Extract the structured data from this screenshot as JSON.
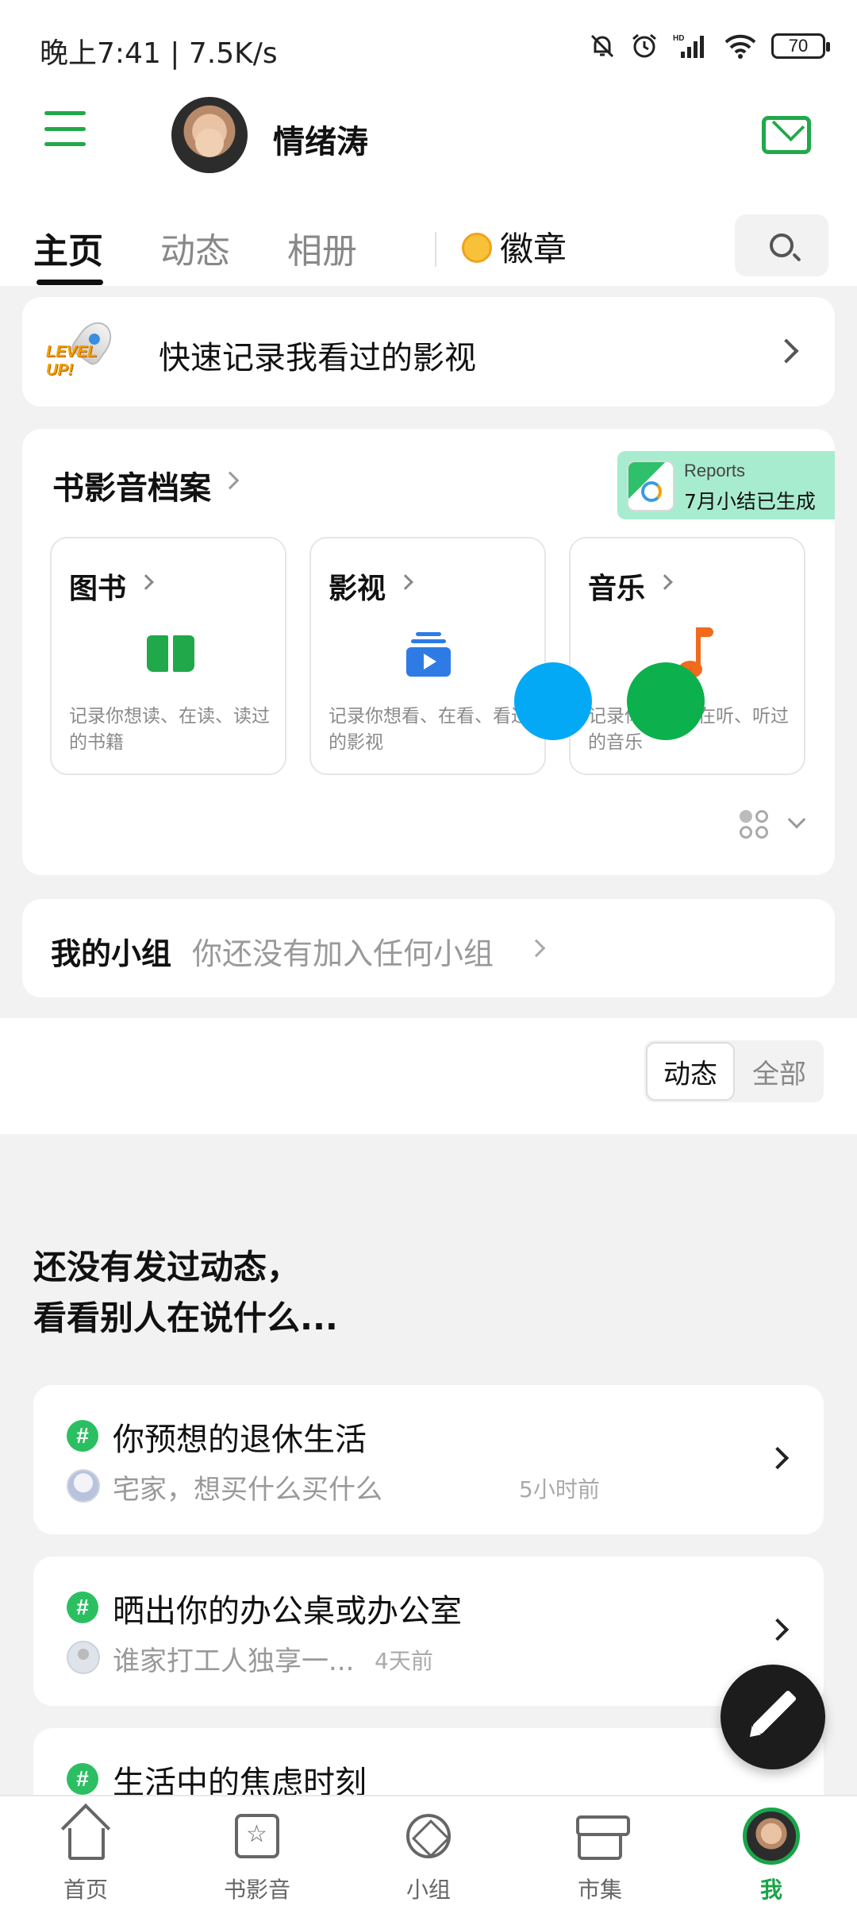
{
  "status_bar": {
    "time": "晚上7:41 | 7.5K/s",
    "battery": "70"
  },
  "header": {
    "username": "情绪涛"
  },
  "tabs": [
    {
      "label": "主页"
    },
    {
      "label": "动态"
    },
    {
      "label": "相册"
    }
  ],
  "badge_tab": {
    "label": "徽章"
  },
  "quick_record": {
    "badge_text": "LEVEL UP!",
    "text": "快速记录我看过的影视"
  },
  "archive": {
    "title": "书影音档案",
    "reports": {
      "label": "Reports",
      "message": "7月小结已生成"
    },
    "items": [
      {
        "title": "图书",
        "desc": "记录你想读、在读、读过的书籍"
      },
      {
        "title": "影视",
        "desc": "记录你想看、在看、看过的影视"
      },
      {
        "title": "音乐",
        "desc": "记录你想听、在听、听过的音乐"
      }
    ]
  },
  "group": {
    "title": "我的小组",
    "subtitle": "你还没有加入任何小组"
  },
  "filter": {
    "active": "动态",
    "inactive": "全部"
  },
  "empty_state": {
    "line1": "还没有发过动态，",
    "line2": "看看别人在说什么..."
  },
  "topics": [
    {
      "title": "你预想的退休生活",
      "subtitle": "宅家，想买什么买什么",
      "time": "5小时前"
    },
    {
      "title": "晒出你的办公桌或办公室",
      "subtitle": "谁家打工人独享一...",
      "time": "4天前"
    },
    {
      "title": "生活中的焦虑时刻",
      "subtitle": "",
      "time": ""
    }
  ],
  "bottom_nav": [
    {
      "label": "首页",
      "icon": "home-icon"
    },
    {
      "label": "书影音",
      "icon": "media-icon"
    },
    {
      "label": "小组",
      "icon": "group-icon"
    },
    {
      "label": "市集",
      "icon": "market-icon"
    },
    {
      "label": "我",
      "icon": "profile-avatar-icon"
    }
  ],
  "colors": {
    "accent": "#21a84a",
    "book": "#21a84a",
    "film": "#2e7be6",
    "music": "#f26a1b",
    "overlay_blue": "#03a9f4",
    "overlay_green": "#0cb04c"
  }
}
